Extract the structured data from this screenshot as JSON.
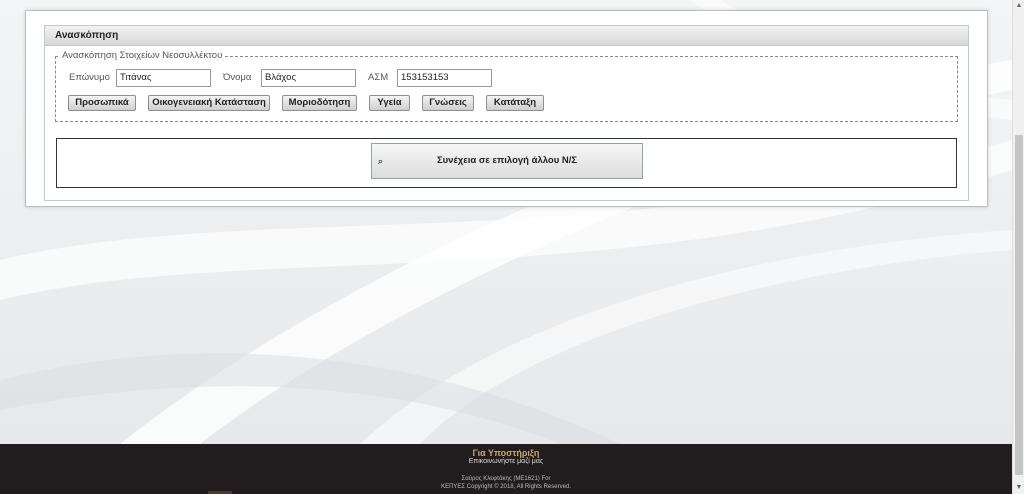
{
  "panel": {
    "title": "Ανασκόπηση"
  },
  "overview": {
    "legend": "Ανασκόπηση Στοιχείων Νεοσυλλέκτου",
    "fields": {
      "surname_label": "Επώνυμο",
      "surname_value": "Τιτάνας",
      "name_label": "Όνομα",
      "name_value": "Βλάχος",
      "afm_label": "ΑΣΜ",
      "afm_value": "153153153"
    },
    "buttons": [
      "Προσωπικά",
      "Οικογενειακή Κατάσταση",
      "Μοριοδότηση",
      "Υγεία",
      "Γνώσεις",
      "Κατάταξη"
    ]
  },
  "continue": {
    "icon": "search-icon",
    "label": "Συνέχεια σε επιλογή άλλου Ν/Σ"
  },
  "footer": {
    "title": "Για Υποστήριξη",
    "contact": "Επικοινωνήστε μαζί μας",
    "author": "Σαύρος Κλεφτάκης (ΜΕ1621) For",
    "copyright": "ΚΕΠΥΕΣ Copyright © 2018, All Rights Reserved."
  }
}
